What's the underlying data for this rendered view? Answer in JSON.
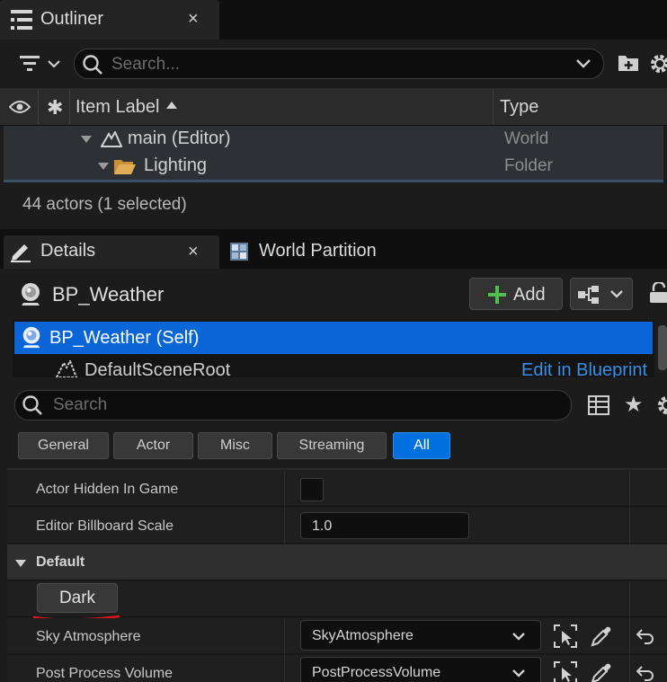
{
  "outliner": {
    "tab_title": "Outliner",
    "close_glyph": "×",
    "search_placeholder": "Search...",
    "columns": {
      "label": "Item Label",
      "type": "Type"
    },
    "rows": [
      {
        "label": "main (Editor)",
        "type": "World",
        "icon": "world-icon"
      },
      {
        "label": "Lighting",
        "type": "Folder",
        "icon": "folder-icon"
      }
    ],
    "status": "44 actors (1 selected)"
  },
  "details": {
    "tabs": [
      {
        "label": "Details"
      },
      {
        "label": "World Partition"
      }
    ],
    "close_glyph": "×",
    "actor_name": "BP_Weather",
    "add_label": "Add",
    "components": [
      {
        "label": "BP_Weather (Self)",
        "selected": true
      },
      {
        "label": "DefaultSceneRoot",
        "selected": false
      }
    ],
    "edit_in_blueprint": "Edit in Blueprint",
    "search_placeholder": "Search",
    "filters": [
      {
        "label": "General",
        "active": false
      },
      {
        "label": "Actor",
        "active": false
      },
      {
        "label": "Misc",
        "active": false
      },
      {
        "label": "Streaming",
        "active": false
      },
      {
        "label": "All",
        "active": true
      }
    ],
    "properties": {
      "actor_hidden_label": "Actor Hidden In Game",
      "actor_hidden_checked": false,
      "billboard_label": "Editor Billboard Scale",
      "billboard_value": "1.0",
      "default_section": "Default",
      "dark_button": "Dark",
      "sky_label": "Sky Atmosphere",
      "sky_value": "SkyAtmosphere",
      "ppv_label": "Post Process Volume",
      "ppv_value": "PostProcessVolume"
    }
  },
  "colors": {
    "accent_blue": "#0a66d6",
    "selection": "#0070e0",
    "add_green": "#4fc04f",
    "folder": "#d8a24a",
    "annotation_red": "#e0141e"
  }
}
